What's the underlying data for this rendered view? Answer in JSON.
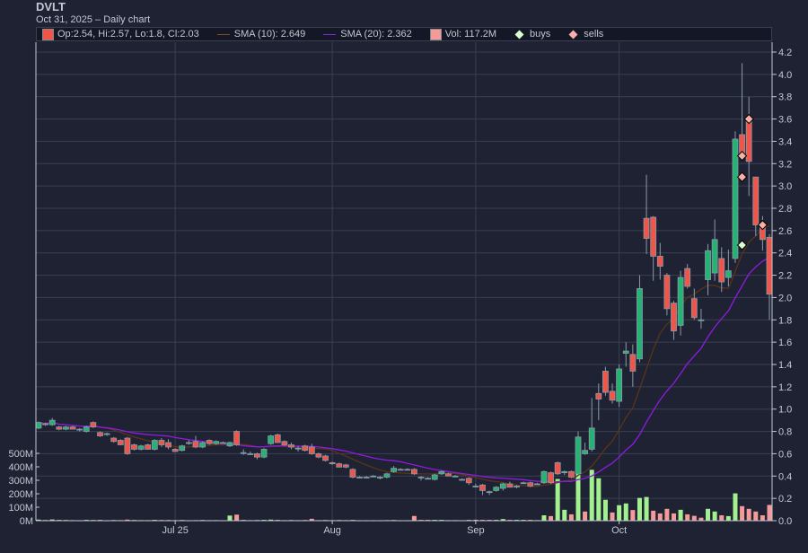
{
  "header": {
    "title": "DVLT",
    "subtitle": "Oct 31, 2025 – Daily chart"
  },
  "legend": {
    "ohlc": "Op:2.54, Hi:2.57, Lo:1.8, Cl:2.03",
    "sma10": "SMA (10): 2.649",
    "sma20": "SMA (20): 2.362",
    "volume": "Vol: 117.2M",
    "buys": "buys",
    "sells": "sells"
  },
  "colors": {
    "up": "#26b273",
    "down": "#f0554a",
    "vol_up": "#a3f08f",
    "vol_down": "#f49a9a",
    "sma10": "#5a3418",
    "sma20": "#8f1be0",
    "buy": "#d8ffd0",
    "sell": "#f8b0a8",
    "grid": "#3a4052"
  },
  "chart_data": {
    "type": "candlestick",
    "title": "DVLT",
    "price_axis": {
      "ylim": [
        0,
        4.2
      ],
      "ticks": [
        "0.0",
        "0.2",
        "0.4",
        "0.6",
        "0.8",
        "1.0",
        "1.2",
        "1.4",
        "1.6",
        "1.8",
        "2.0",
        "2.2",
        "2.4",
        "2.6",
        "2.8",
        "3.0",
        "3.2",
        "3.4",
        "3.6",
        "3.8",
        "4.0",
        "4.2"
      ]
    },
    "volume_axis": {
      "ylim_M": [
        0,
        500
      ],
      "ticks": [
        "0M",
        "100M",
        "200M",
        "300M",
        "400M",
        "500M"
      ]
    },
    "x_ticks": [
      {
        "bar": 20,
        "label": "Jul 25"
      },
      {
        "bar": 43,
        "label": "Aug"
      },
      {
        "bar": 64,
        "label": "Sep"
      },
      {
        "bar": 85,
        "label": "Oct"
      }
    ],
    "bar_fields": [
      "open",
      "high",
      "low",
      "close",
      "volume_M"
    ],
    "bars": [
      [
        0.83,
        0.89,
        0.82,
        0.88,
        8
      ],
      [
        0.87,
        0.88,
        0.85,
        0.86,
        5
      ],
      [
        0.86,
        0.92,
        0.85,
        0.9,
        9
      ],
      [
        0.84,
        0.85,
        0.81,
        0.82,
        6
      ],
      [
        0.82,
        0.85,
        0.81,
        0.84,
        5
      ],
      [
        0.84,
        0.85,
        0.82,
        0.82,
        4
      ],
      [
        0.82,
        0.83,
        0.8,
        0.82,
        3
      ],
      [
        0.8,
        0.85,
        0.79,
        0.84,
        6
      ],
      [
        0.88,
        0.89,
        0.83,
        0.84,
        5
      ],
      [
        0.79,
        0.8,
        0.75,
        0.76,
        6
      ],
      [
        0.78,
        0.79,
        0.76,
        0.78,
        3
      ],
      [
        0.74,
        0.75,
        0.7,
        0.71,
        5
      ],
      [
        0.72,
        0.73,
        0.68,
        0.68,
        4
      ],
      [
        0.74,
        0.75,
        0.59,
        0.6,
        8
      ],
      [
        0.68,
        0.69,
        0.63,
        0.64,
        5
      ],
      [
        0.64,
        0.68,
        0.63,
        0.67,
        4
      ],
      [
        0.68,
        0.69,
        0.64,
        0.64,
        4
      ],
      [
        0.64,
        0.73,
        0.63,
        0.72,
        6
      ],
      [
        0.72,
        0.74,
        0.66,
        0.68,
        5
      ],
      [
        0.7,
        0.73,
        0.64,
        0.66,
        5
      ],
      [
        0.64,
        0.65,
        0.62,
        0.62,
        4
      ],
      [
        0.63,
        0.68,
        0.62,
        0.67,
        5
      ],
      [
        0.7,
        0.72,
        0.68,
        0.7,
        3
      ],
      [
        0.71,
        0.76,
        0.65,
        0.66,
        4
      ],
      [
        0.66,
        0.71,
        0.65,
        0.7,
        5
      ],
      [
        0.72,
        0.73,
        0.68,
        0.69,
        4
      ],
      [
        0.69,
        0.72,
        0.68,
        0.71,
        4
      ],
      [
        0.7,
        0.71,
        0.69,
        0.7,
        3
      ],
      [
        0.67,
        0.71,
        0.66,
        0.7,
        38
      ],
      [
        0.8,
        0.81,
        0.67,
        0.68,
        45
      ],
      [
        0.61,
        0.64,
        0.59,
        0.61,
        6
      ],
      [
        0.6,
        0.62,
        0.59,
        0.6,
        4
      ],
      [
        0.6,
        0.61,
        0.55,
        0.57,
        5
      ],
      [
        0.57,
        0.65,
        0.56,
        0.64,
        6
      ],
      [
        0.69,
        0.77,
        0.68,
        0.76,
        8
      ],
      [
        0.77,
        0.78,
        0.7,
        0.7,
        6
      ],
      [
        0.71,
        0.72,
        0.67,
        0.68,
        4
      ],
      [
        0.68,
        0.7,
        0.64,
        0.66,
        5
      ],
      [
        0.65,
        0.67,
        0.62,
        0.65,
        4
      ],
      [
        0.67,
        0.68,
        0.62,
        0.63,
        5
      ],
      [
        0.66,
        0.69,
        0.59,
        0.6,
        14
      ],
      [
        0.6,
        0.61,
        0.56,
        0.57,
        4
      ],
      [
        0.58,
        0.59,
        0.53,
        0.54,
        5
      ],
      [
        0.52,
        0.53,
        0.5,
        0.51,
        4
      ],
      [
        0.51,
        0.52,
        0.48,
        0.48,
        5
      ],
      [
        0.5,
        0.51,
        0.47,
        0.48,
        4
      ],
      [
        0.46,
        0.47,
        0.38,
        0.39,
        6
      ],
      [
        0.39,
        0.4,
        0.38,
        0.39,
        3
      ],
      [
        0.39,
        0.4,
        0.38,
        0.39,
        3
      ],
      [
        0.4,
        0.41,
        0.39,
        0.4,
        3
      ],
      [
        0.39,
        0.4,
        0.37,
        0.39,
        3
      ],
      [
        0.39,
        0.43,
        0.38,
        0.42,
        4
      ],
      [
        0.44,
        0.49,
        0.43,
        0.47,
        5
      ],
      [
        0.46,
        0.47,
        0.45,
        0.46,
        3
      ],
      [
        0.46,
        0.47,
        0.45,
        0.46,
        3
      ],
      [
        0.46,
        0.47,
        0.41,
        0.42,
        35
      ],
      [
        0.39,
        0.4,
        0.36,
        0.39,
        6
      ],
      [
        0.38,
        0.39,
        0.37,
        0.38,
        6
      ],
      [
        0.37,
        0.42,
        0.36,
        0.41,
        6
      ],
      [
        0.42,
        0.45,
        0.41,
        0.44,
        6
      ],
      [
        0.42,
        0.43,
        0.4,
        0.4,
        4
      ],
      [
        0.4,
        0.41,
        0.39,
        0.4,
        4
      ],
      [
        0.37,
        0.38,
        0.36,
        0.37,
        3
      ],
      [
        0.38,
        0.39,
        0.32,
        0.34,
        6
      ],
      [
        0.31,
        0.33,
        0.3,
        0.31,
        7
      ],
      [
        0.32,
        0.33,
        0.23,
        0.27,
        6
      ],
      [
        0.26,
        0.27,
        0.23,
        0.26,
        6
      ],
      [
        0.27,
        0.31,
        0.26,
        0.3,
        6
      ],
      [
        0.29,
        0.34,
        0.27,
        0.33,
        12
      ],
      [
        0.33,
        0.35,
        0.3,
        0.3,
        6
      ],
      [
        0.31,
        0.32,
        0.29,
        0.31,
        6
      ],
      [
        0.34,
        0.35,
        0.33,
        0.34,
        6
      ],
      [
        0.34,
        0.35,
        0.3,
        0.31,
        6
      ],
      [
        0.33,
        0.34,
        0.32,
        0.33,
        4
      ],
      [
        0.34,
        0.45,
        0.33,
        0.44,
        40
      ],
      [
        0.43,
        0.44,
        0.33,
        0.34,
        34
      ],
      [
        0.52,
        0.53,
        0.41,
        0.42,
        310
      ],
      [
        0.43,
        0.45,
        0.41,
        0.44,
        81
      ],
      [
        0.44,
        0.45,
        0.38,
        0.39,
        47
      ],
      [
        0.42,
        0.8,
        0.41,
        0.75,
        372
      ],
      [
        0.6,
        0.7,
        0.59,
        0.63,
        68
      ],
      [
        0.64,
        1.1,
        0.62,
        0.83,
        378
      ],
      [
        1.14,
        1.23,
        0.9,
        1.09,
        315
      ],
      [
        1.34,
        1.38,
        1.12,
        1.15,
        155
      ],
      [
        1.16,
        1.23,
        1.05,
        1.08,
        61
      ],
      [
        1.07,
        1.4,
        1.02,
        1.36,
        115
      ],
      [
        1.5,
        1.6,
        1.38,
        1.52,
        128
      ],
      [
        1.49,
        1.58,
        1.2,
        1.34,
        79
      ],
      [
        1.45,
        2.2,
        1.42,
        2.08,
        169
      ],
      [
        2.71,
        3.1,
        2.39,
        2.53,
        176
      ],
      [
        2.72,
        2.73,
        2.15,
        2.37,
        74
      ],
      [
        2.37,
        2.49,
        2.16,
        2.28,
        54
      ],
      [
        2.2,
        2.22,
        1.84,
        1.9,
        88
      ],
      [
        1.95,
        1.97,
        1.62,
        1.7,
        54
      ],
      [
        1.75,
        2.24,
        1.66,
        2.18,
        81
      ],
      [
        2.26,
        2.3,
        2.08,
        2.1,
        47
      ],
      [
        1.99,
        2.08,
        1.8,
        1.82,
        36
      ],
      [
        1.8,
        1.9,
        1.72,
        1.8,
        22
      ],
      [
        2.16,
        2.48,
        2.02,
        2.42,
        88
      ],
      [
        2.22,
        2.7,
        2.15,
        2.52,
        68
      ],
      [
        2.35,
        2.45,
        2.05,
        2.14,
        40
      ],
      [
        2.18,
        2.43,
        2.1,
        2.24,
        34
      ],
      [
        2.35,
        3.49,
        2.31,
        3.42,
        203
      ],
      [
        3.46,
        4.1,
        3.23,
        3.28,
        108
      ],
      [
        3.6,
        3.8,
        2.91,
        3.22,
        88
      ],
      [
        3.08,
        3.08,
        2.55,
        2.65,
        68
      ],
      [
        2.64,
        2.73,
        2.42,
        2.52,
        40
      ],
      [
        2.54,
        2.57,
        1.8,
        2.03,
        117.2
      ]
    ],
    "buys": [
      {
        "bar": 103,
        "price": 2.47
      }
    ],
    "sells": [
      {
        "bar": 103,
        "price": 3.27
      },
      {
        "bar": 103,
        "price": 3.08
      },
      {
        "bar": 104,
        "price": 3.6
      },
      {
        "bar": 106,
        "price": 2.65
      }
    ],
    "series": [
      {
        "name": "SMA (10)",
        "period": 10
      },
      {
        "name": "SMA (20)",
        "period": 20
      }
    ]
  }
}
